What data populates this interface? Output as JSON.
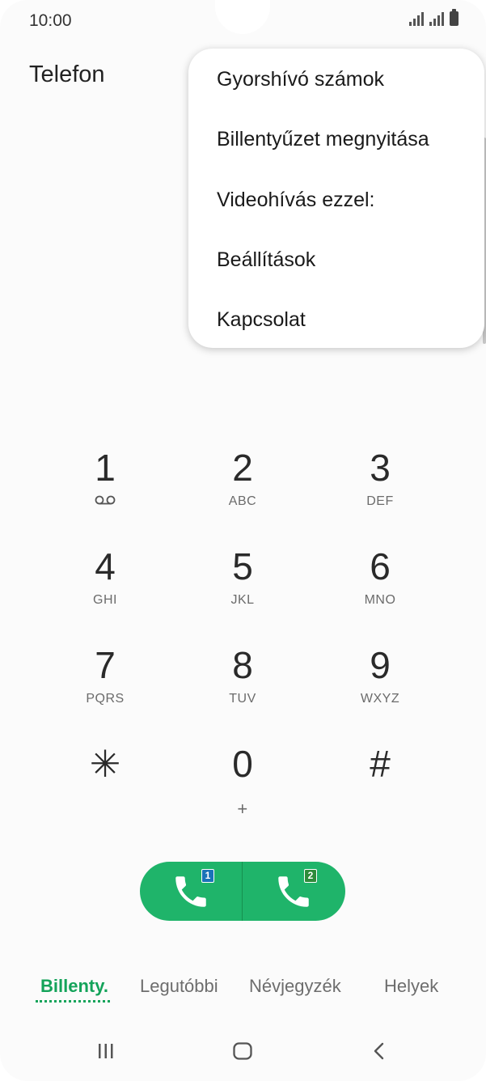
{
  "status_bar": {
    "time": "10:00"
  },
  "header": {
    "title": "Telefon"
  },
  "menu": {
    "items": [
      {
        "label": "Gyorshívó számok"
      },
      {
        "label": "Billentyűzet megnyitása"
      },
      {
        "label": "Videohívás ezzel:"
      },
      {
        "label": "Beállítások"
      },
      {
        "label": "Kapcsolat"
      }
    ]
  },
  "keypad": {
    "keys": [
      {
        "digit": "1",
        "letters": ""
      },
      {
        "digit": "2",
        "letters": "ABC"
      },
      {
        "digit": "3",
        "letters": "DEF"
      },
      {
        "digit": "4",
        "letters": "GHI"
      },
      {
        "digit": "5",
        "letters": "JKL"
      },
      {
        "digit": "6",
        "letters": "MNO"
      },
      {
        "digit": "7",
        "letters": "PQRS"
      },
      {
        "digit": "8",
        "letters": "TUV"
      },
      {
        "digit": "9",
        "letters": "WXYZ"
      },
      {
        "digit": "✳",
        "letters": ""
      },
      {
        "digit": "0",
        "letters": "+"
      },
      {
        "digit": "#",
        "letters": ""
      }
    ]
  },
  "call_buttons": {
    "sim1_badge": "1",
    "sim2_badge": "2",
    "accent_color": "#1fb46a",
    "sim1_color": "#1a73b8",
    "sim2_color": "#2e8b3a"
  },
  "tabs": [
    {
      "label": "Billenty.",
      "active": true
    },
    {
      "label": "Legutóbbi",
      "active": false
    },
    {
      "label": "Névjegyzék",
      "active": false
    },
    {
      "label": "Helyek",
      "active": false
    }
  ],
  "navigation": {
    "icons": [
      "recents-icon",
      "home-icon",
      "back-icon"
    ]
  }
}
